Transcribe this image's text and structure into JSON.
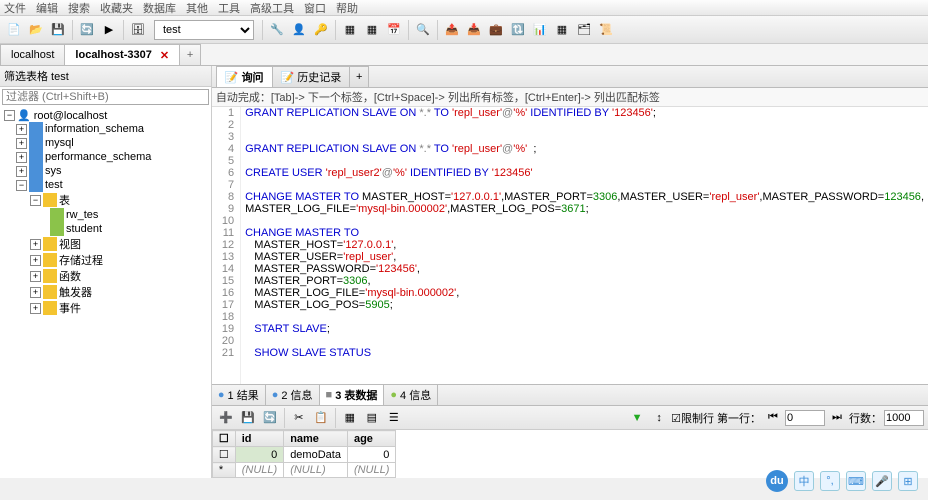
{
  "menu": [
    "文件",
    "编辑",
    "搜索",
    "收藏夹",
    "数据库",
    "其他",
    "工具",
    "高级工具",
    "窗口",
    "帮助"
  ],
  "db_selected": "test",
  "top_tabs": [
    {
      "label": "localhost",
      "active": false,
      "closable": false
    },
    {
      "label": "localhost-3307",
      "active": true,
      "closable": true
    }
  ],
  "sidebar": {
    "filter_label": "筛选表格 test",
    "filter_placeholder": "过滤器 (Ctrl+Shift+B)",
    "root": "root@localhost",
    "dbs": [
      "information_schema",
      "mysql",
      "performance_schema",
      "sys"
    ],
    "open_db": "test",
    "tables_label": "表",
    "tables": [
      "rw_tes",
      "student"
    ],
    "folders": [
      "视图",
      "存储过程",
      "函数",
      "触发器",
      "事件"
    ]
  },
  "inner_tabs": [
    {
      "label": "询问",
      "active": true
    },
    {
      "label": "历史记录",
      "active": false
    }
  ],
  "hint": "自动完成：[Tab]-> 下一个标签，[Ctrl+Space]-> 列出所有标签，[Ctrl+Enter]-> 列出匹配标签",
  "code_lines": [
    {
      "n": 1,
      "html": "<span class='kw'>GRANT</span> <span class='kw'>REPLICATION</span> <span class='kw'>SLAVE</span> <span class='kw'>ON</span> <span class='op'>*.*</span> <span class='kw'>TO</span> <span class='str'>'repl_user'</span><span class='op'>@</span><span class='str'>'%'</span> <span class='kw'>IDENTIFIED BY</span> <span class='str'>'123456'</span>;"
    },
    {
      "n": 2,
      "html": ""
    },
    {
      "n": 3,
      "html": ""
    },
    {
      "n": 4,
      "html": "<span class='kw'>GRANT</span> <span class='kw'>REPLICATION</span> <span class='kw'>SLAVE</span> <span class='kw'>ON</span> <span class='op'>*.*</span> <span class='kw'>TO</span> <span class='str'>'repl_user'</span><span class='op'>@</span><span class='str'>'%'</span>  ;"
    },
    {
      "n": 5,
      "html": ""
    },
    {
      "n": 6,
      "html": "<span class='kw'>CREATE USER</span> <span class='str'>'repl_user2'</span><span class='op'>@</span><span class='str'>'%'</span> <span class='kw'>IDENTIFIED BY</span> <span class='str'>'123456'</span>"
    },
    {
      "n": 7,
      "html": ""
    },
    {
      "n": 8,
      "html": "<span class='kw'>CHANGE MASTER TO</span> MASTER_HOST=<span class='str'>'127.0.0.1'</span>,MASTER_PORT=<span class='num'>3306</span>,MASTER_USER=<span class='str'>'repl_user'</span>,MASTER_PASSWORD=<span class='num'>123456</span>,"
    },
    {
      "n": 9,
      "html": "MASTER_LOG_FILE=<span class='str'>'mysql-bin.000002'</span>,MASTER_LOG_POS=<span class='num'>3671</span>;"
    },
    {
      "n": 10,
      "html": ""
    },
    {
      "n": 11,
      "html": "<span class='kw'>CHANGE MASTER TO</span>"
    },
    {
      "n": 12,
      "html": "   MASTER_HOST=<span class='str'>'127.0.0.1'</span>,"
    },
    {
      "n": 13,
      "html": "   MASTER_USER=<span class='str'>'repl_user'</span>,"
    },
    {
      "n": 14,
      "html": "   MASTER_PASSWORD=<span class='str'>'123456'</span>,"
    },
    {
      "n": 15,
      "html": "   MASTER_PORT=<span class='num'>3306</span>,"
    },
    {
      "n": 16,
      "html": "   MASTER_LOG_FILE=<span class='str'>'mysql-bin.000002'</span>,"
    },
    {
      "n": 17,
      "html": "   MASTER_LOG_POS=<span class='num'>5905</span>;"
    },
    {
      "n": 18,
      "html": ""
    },
    {
      "n": 19,
      "html": "   <span class='kw'>START</span> <span class='kw'>SLAVE</span>;"
    },
    {
      "n": 20,
      "html": ""
    },
    {
      "n": 21,
      "html": "   <span class='kw'>SHOW</span> <span class='kw'>SLAVE</span> <span class='kw'>STATUS</span>"
    }
  ],
  "result_tabs": [
    {
      "label": "1 结果",
      "icon": "●",
      "color": "#4a90d9"
    },
    {
      "label": "2 信息",
      "icon": "●",
      "color": "#4a90d9"
    },
    {
      "label": "3 表数据",
      "icon": "■",
      "color": "#888",
      "active": true
    },
    {
      "label": "4 信息",
      "icon": "●",
      "color": "#8bc34a"
    }
  ],
  "res_toolbar": {
    "limit_label": "☑限制行 第一行：",
    "first_row": "0",
    "rows_label": "行数：",
    "rows": "1000"
  },
  "grid": {
    "cols": [
      "id",
      "name",
      "age"
    ],
    "rows": [
      {
        "id": "0",
        "name": "demoData",
        "age": "0"
      },
      {
        "id": "(NULL)",
        "name": "(NULL)",
        "age": "(NULL)",
        "null": true,
        "marker": "*"
      }
    ]
  },
  "float": {
    "circle": "du",
    "lang": "中"
  }
}
